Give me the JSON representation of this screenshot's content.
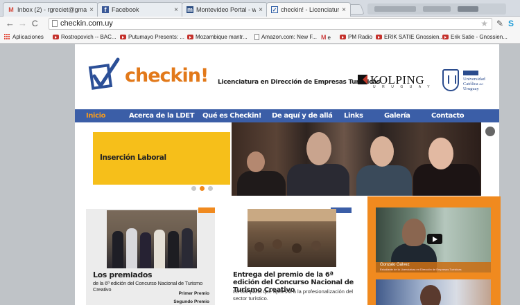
{
  "browser": {
    "tabs": [
      {
        "label": "Inbox (2) - rgreciet@gma",
        "icon": "gmail-icon",
        "close": "×"
      },
      {
        "label": "Facebook",
        "icon": "facebook-icon",
        "close": "×"
      },
      {
        "label": "Montevideo Portal - www.",
        "icon": "montevideo-portal-icon",
        "close": "×"
      },
      {
        "label": "checkin! - Licenciatura en",
        "icon": "checkin-icon",
        "close": "×",
        "active": true
      }
    ],
    "url": "checkin.com.uy",
    "bookmarks": [
      {
        "label": "Aplicaciones",
        "icon": "apps-icon"
      },
      {
        "label": "Rostropovich -- BAC...",
        "icon": "youtube-icon"
      },
      {
        "label": "Putumayo Presents: ...",
        "icon": "youtube-icon"
      },
      {
        "label": "Mozambique mantr...",
        "icon": "youtube-icon"
      },
      {
        "label": "Amazon.com: New F...",
        "icon": "page-icon"
      },
      {
        "label": "e",
        "icon": "gmail-icon"
      },
      {
        "label": "PM Radio",
        "icon": "youtube-icon"
      },
      {
        "label": "ERIK SATIE Gnossien...",
        "icon": "youtube-icon"
      },
      {
        "label": "Erik Satie - Gnossien...",
        "icon": "youtube-icon"
      }
    ]
  },
  "site": {
    "logo_text": "checkin!",
    "header_title": "Licenciatura en Dirección de Empresas Turísticas",
    "kolping": {
      "name": "KOLPING",
      "sub": "URUGUAY"
    },
    "ucu": {
      "line1": "Universidad",
      "line2": "Católica",
      "line3": "del",
      "line4": "Uruguay"
    },
    "nav": [
      "Inicio",
      "Acerca de la LDET",
      "Qué es Checkin!",
      "De aquí y de allá",
      "Links",
      "Galería",
      "Contacto"
    ],
    "slider": {
      "title": "Inserción Laboral",
      "active_dot": 2,
      "dot_count": 3
    },
    "card1": {
      "title": "Los premiados",
      "subtitle": "de la 6ª edición del Concurso Nacional de Turismo Creativo",
      "prize1": "Primer Premio",
      "prize2": "Segundo Premio"
    },
    "card2": {
      "title": "Entrega del premio de la 6ª edición del Concurso Nacional de Turismo Creativo",
      "desc": "La campaña que apuesta a la profesionalización del sector turístico."
    },
    "card3": {
      "video_name": "Gonzalo Gálvez",
      "video_role": "Estudiante de la Licenciatura en Dirección de Empresas Turísticas"
    }
  },
  "colors": {
    "nav_blue": "#3b5ea7",
    "accent_orange": "#f08a1f",
    "panel_yellow": "#f6bf1a",
    "logo_orange": "#e2791a"
  }
}
